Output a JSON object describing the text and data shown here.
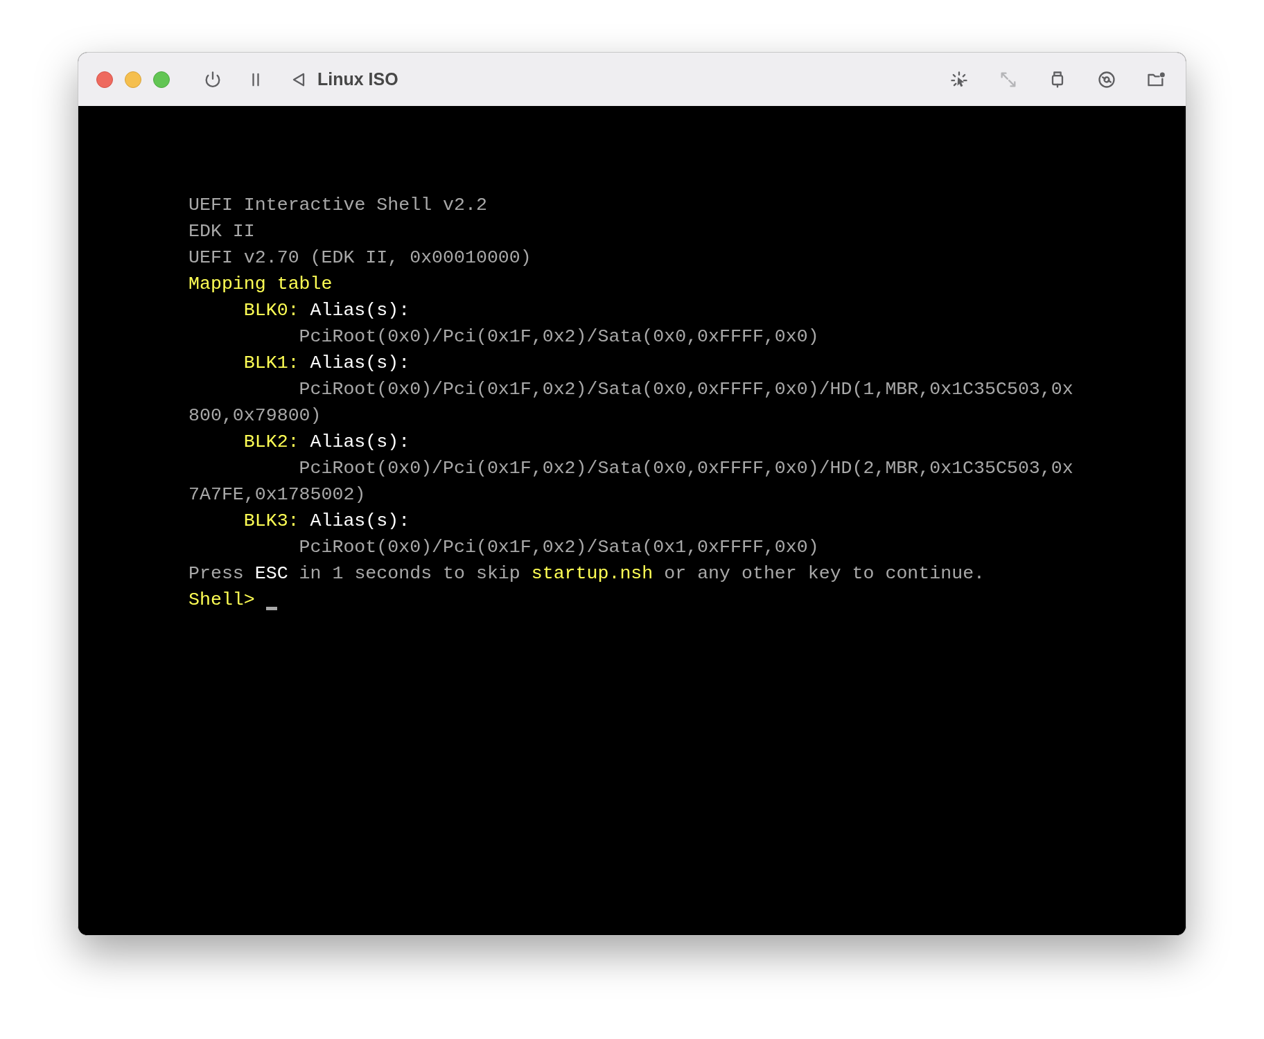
{
  "window": {
    "title": "Linux ISO"
  },
  "toolbar_left": [
    {
      "kind": "power",
      "disabled": false
    },
    {
      "kind": "pause",
      "disabled": false
    },
    {
      "kind": "back",
      "disabled": false
    }
  ],
  "toolbar_right": [
    {
      "kind": "capture",
      "disabled": false
    },
    {
      "kind": "resize",
      "disabled": true
    },
    {
      "kind": "usb",
      "disabled": false
    },
    {
      "kind": "disc",
      "disabled": false
    },
    {
      "kind": "folder",
      "disabled": false
    }
  ],
  "console": {
    "lines": [
      {
        "kind": "plain",
        "segments": [
          {
            "text": "UEFI Interactive Shell v2.2",
            "kind": "normal"
          }
        ]
      },
      {
        "kind": "plain",
        "segments": [
          {
            "text": "EDK II",
            "kind": "normal"
          }
        ]
      },
      {
        "kind": "plain",
        "segments": [
          {
            "text": "UEFI v2.70 (EDK II, 0x00010000)",
            "kind": "normal"
          }
        ]
      },
      {
        "kind": "plain",
        "segments": [
          {
            "text": "Mapping table",
            "kind": "highlight"
          }
        ]
      },
      {
        "kind": "entry",
        "segments": [
          {
            "text": "BLK0:",
            "kind": "highlight"
          },
          {
            "text": "Alias(s):",
            "kind": "bright"
          }
        ]
      },
      {
        "kind": "path",
        "segments": [
          {
            "text": "PciRoot(0x0)/Pci(0x1F,0x2)/Sata(0x0,0xFFFF,0x0)",
            "kind": "normal"
          }
        ]
      },
      {
        "kind": "entry",
        "segments": [
          {
            "text": "BLK1:",
            "kind": "highlight"
          },
          {
            "text": "Alias(s):",
            "kind": "bright"
          }
        ]
      },
      {
        "kind": "path",
        "segments": [
          {
            "text": "PciRoot(0x0)/Pci(0x1F,0x2)/Sata(0x0,0xFFFF,0x0)/HD(1,MBR,0x1C35C503,0x",
            "kind": "normal"
          }
        ]
      },
      {
        "kind": "plain",
        "segments": [
          {
            "text": "800,0x79800)",
            "kind": "normal"
          }
        ]
      },
      {
        "kind": "entry",
        "segments": [
          {
            "text": "BLK2:",
            "kind": "highlight"
          },
          {
            "text": "Alias(s):",
            "kind": "bright"
          }
        ]
      },
      {
        "kind": "path",
        "segments": [
          {
            "text": "PciRoot(0x0)/Pci(0x1F,0x2)/Sata(0x0,0xFFFF,0x0)/HD(2,MBR,0x1C35C503,0x",
            "kind": "normal"
          }
        ]
      },
      {
        "kind": "plain",
        "segments": [
          {
            "text": "7A7FE,0x1785002)",
            "kind": "normal"
          }
        ]
      },
      {
        "kind": "entry",
        "segments": [
          {
            "text": "BLK3:",
            "kind": "highlight"
          },
          {
            "text": "Alias(s):",
            "kind": "bright"
          }
        ]
      },
      {
        "kind": "path",
        "segments": [
          {
            "text": "PciRoot(0x0)/Pci(0x1F,0x2)/Sata(0x1,0xFFFF,0x0)",
            "kind": "normal"
          }
        ]
      },
      {
        "kind": "plain",
        "segments": [
          {
            "text": "Press",
            "kind": "normal"
          },
          {
            "text": "ESC",
            "kind": "bright"
          },
          {
            "text": "in 1 seconds to skip",
            "kind": "normal"
          },
          {
            "text": "startup.nsh",
            "kind": "highlight"
          },
          {
            "text": "or any other key to continue.",
            "kind": "normal"
          }
        ]
      }
    ],
    "prompt": {
      "text": "Shell>",
      "cursor": true
    }
  }
}
